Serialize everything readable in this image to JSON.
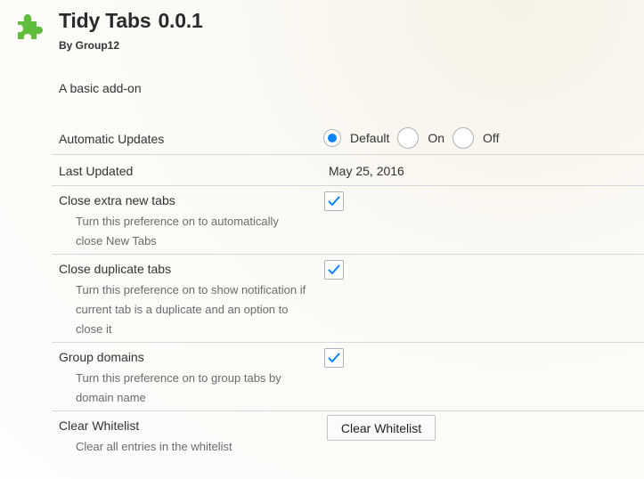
{
  "addon": {
    "name": "Tidy Tabs",
    "version": "0.0.1",
    "creator": "By Group12",
    "description": "A basic add-on",
    "icon": "puzzle-piece-icon",
    "icon_color": "#5fbd3b"
  },
  "auto_updates": {
    "label": "Automatic Updates",
    "options": [
      "Default",
      "On",
      "Off"
    ],
    "selected": "Default"
  },
  "last_updated": {
    "label": "Last Updated",
    "value": "May 25, 2016"
  },
  "prefs": [
    {
      "label": "Close extra new tabs",
      "help_lines": [
        "Turn this preference on to automatically",
        "close New Tabs"
      ],
      "checked": true
    },
    {
      "label": "Close duplicate tabs",
      "help_lines": [
        "Turn this preference on to show notification if",
        "current tab is a duplicate and an option to",
        "close it"
      ],
      "checked": true
    },
    {
      "label": "Group domains",
      "help_lines": [
        "Turn this preference on to group tabs by",
        "domain name"
      ],
      "checked": true
    }
  ],
  "clear_whitelist": {
    "label": "Clear Whitelist",
    "help": "Clear all entries in the whitelist",
    "button_label": "Clear Whitelist"
  },
  "colors": {
    "accent": "#0a84ff",
    "check": "#0a84ff",
    "divider": "#d7d7db"
  }
}
